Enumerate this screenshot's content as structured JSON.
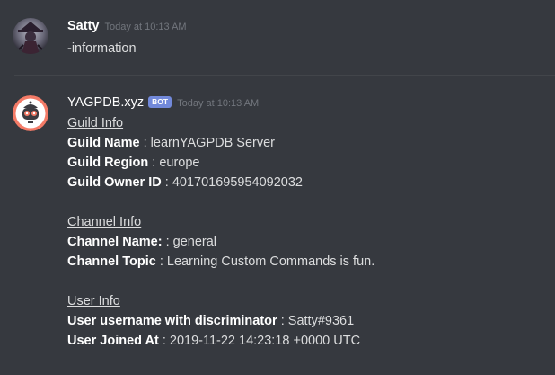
{
  "messages": [
    {
      "username": "Satty",
      "timestamp": "Today at 10:13 AM",
      "text": "-information"
    },
    {
      "username": "YAGPDB.xyz",
      "bot_tag": "BOT",
      "timestamp": "Today at 10:13 AM",
      "sections": [
        {
          "heading": "Guild Info",
          "fields": [
            {
              "label": "Guild Name",
              "sep": " : ",
              "value": "learnYAGPDB Server"
            },
            {
              "label": "Guild Region",
              "sep": " : ",
              "value": "europe"
            },
            {
              "label": "Guild Owner ID",
              "sep": " : ",
              "value": "401701695954092032"
            }
          ]
        },
        {
          "heading": "Channel Info",
          "fields": [
            {
              "label": "Channel Name:",
              "sep": " : ",
              "value": "general"
            },
            {
              "label": "Channel Topic",
              "sep": " : ",
              "value": "Learning Custom Commands is fun."
            }
          ]
        },
        {
          "heading": "User Info",
          "fields": [
            {
              "label": "User username with discriminator",
              "sep": " : ",
              "value": "Satty#9361"
            },
            {
              "label": "User  Joined At",
              "sep": " : ",
              "value": "2019-11-22 14:23:18 +0000 UTC"
            }
          ]
        }
      ]
    }
  ],
  "colors": {
    "background": "#36393f",
    "bot_tag": "#7289da",
    "timestamp": "#72767d",
    "text": "#dcddde",
    "yagpdb_avatar_ring": "#f47b67"
  }
}
